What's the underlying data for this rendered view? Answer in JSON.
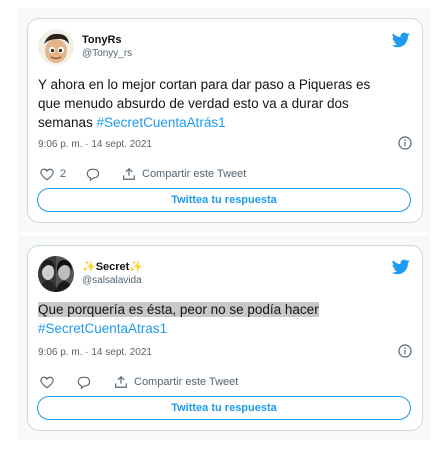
{
  "colors": {
    "accent": "#1d9bf0",
    "text": "#0f1419",
    "muted": "#536471",
    "border": "#cfd9de",
    "highlight": "#c8c8c8"
  },
  "tweets": [
    {
      "display_name": "TonyRs",
      "handle": "@Tonyy_rs",
      "text_line1": "Y ahora en lo mejor cortan para dar paso a Piqueras es",
      "text_line2": "que menudo absurdo de verdad esto va a durar dos",
      "text_line3": "semanas",
      "hashtag": "#SecretCuentaAtrás1",
      "timestamp": "9:06 p. m. · 14 sept. 2021",
      "like_count": "2",
      "share_label": "Compartir este Tweet",
      "reply_label": "Twittea tu respuesta",
      "icons": [
        "twitter-bird-icon",
        "info-icon",
        "heart-icon",
        "reply-bubble-icon",
        "share-icon"
      ]
    },
    {
      "display_name": "Secret",
      "sparkle": "✨",
      "handle": "@salsalavida",
      "text_line1": "Que porquería es ésta, peor no se podía hacer",
      "hashtag": "#SecretCuentaAtras1",
      "timestamp": "9:06 p. m. · 14 sept. 2021",
      "share_label": "Compartir este Tweet",
      "reply_label": "Twittea tu respuesta",
      "icons": [
        "twitter-bird-icon",
        "info-icon",
        "heart-icon",
        "reply-bubble-icon",
        "share-icon"
      ]
    }
  ]
}
